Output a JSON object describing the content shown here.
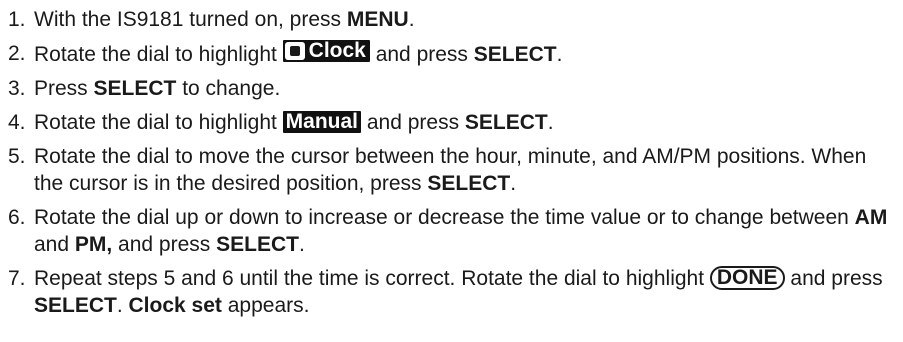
{
  "steps": [
    {
      "num": "1.",
      "t1": "With the IS9181 turned on, press ",
      "b1": "MENU",
      "t2": "."
    },
    {
      "num": "2.",
      "t1": "Rotate the dial to highlight ",
      "highlight": "Clock",
      "t2": " and press ",
      "b1": "SELECT",
      "t3": "."
    },
    {
      "num": "3.",
      "t1": "Press ",
      "b1": "SELECT",
      "t2": " to change."
    },
    {
      "num": "4.",
      "t1": "Rotate the dial to highlight ",
      "highlight": "Manual",
      "t2": " and press ",
      "b1": "SELECT",
      "t3": "."
    },
    {
      "num": "5.",
      "t1": "Rotate the dial to move the cursor between the hour, minute, and AM/PM positions. When the cursor is in the desired position, press ",
      "b1": "SELECT",
      "t2": "."
    },
    {
      "num": "6.",
      "t1": "Rotate the dial up or down to increase or decrease the time value or to change between ",
      "b1": "AM",
      "t2": " and ",
      "b2": "PM,",
      "t3": " and press ",
      "b3": "SELECT",
      "t4": "."
    },
    {
      "num": "7.",
      "t1": "Repeat steps 5 and 6 until the time is correct. Rotate the dial to highlight ",
      "button": "DONE",
      "t2": " and press ",
      "b1": "SELECT",
      "t3": ". ",
      "b2": "Clock set",
      "t4": " appears."
    }
  ],
  "icons": {
    "clock_menu_icon": "clock-icon"
  },
  "colors": {
    "text": "#1a1a1a",
    "highlight_bg": "#111111",
    "highlight_fg": "#ffffff"
  }
}
